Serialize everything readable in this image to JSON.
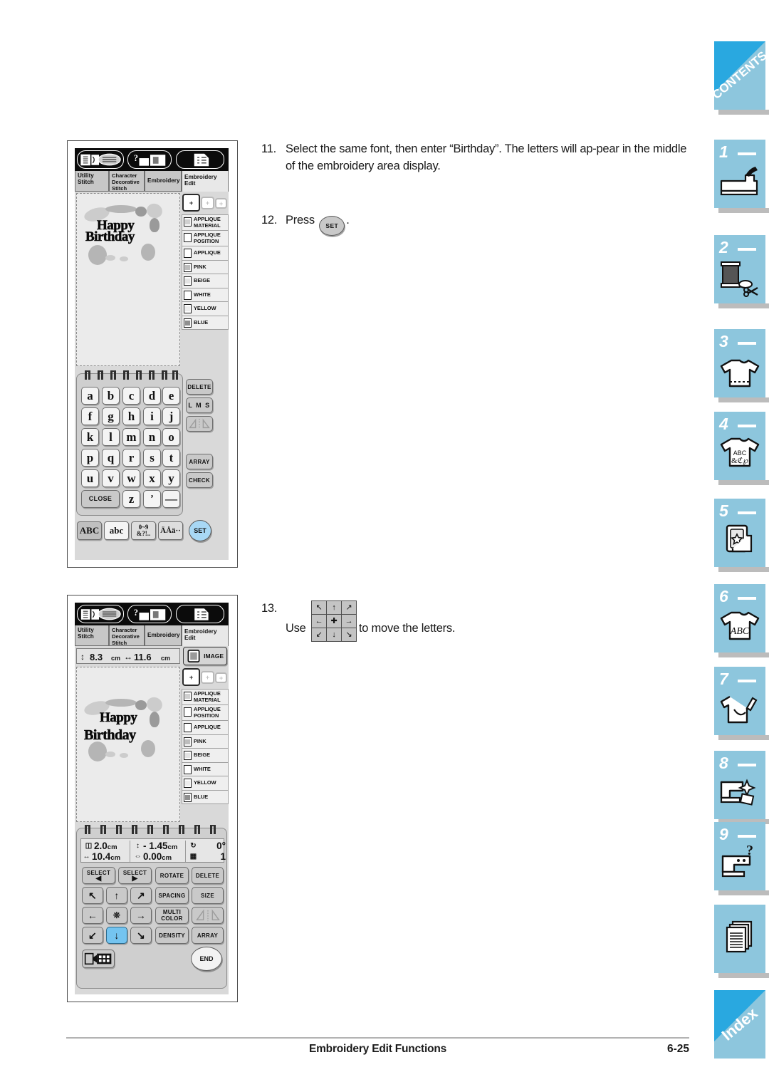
{
  "page": {
    "footer_title": "Embroidery Edit Functions",
    "footer_page": "6-25"
  },
  "instructions": [
    {
      "number": "11.",
      "text": "Select the same font, then enter “Birthday”. The letters will ap-pear in the middle of the embroidery area display."
    },
    {
      "number": "12.",
      "prefix": "Press",
      "button": "SET",
      "suffix": "."
    },
    {
      "number": "13.",
      "prefix": "Use",
      "suffix": "to move the letters."
    }
  ],
  "thumb_tabs": [
    {
      "label": "CONTENTS",
      "type": "corner",
      "icon": "contents-corner-icon"
    },
    {
      "label": "1",
      "type": "numbered",
      "icon": "sewing-machine-icon"
    },
    {
      "label": "2",
      "type": "numbered",
      "icon": "thread-spool-scissors-icon"
    },
    {
      "label": "3",
      "type": "numbered",
      "icon": "tshirt-stitch-icon"
    },
    {
      "label": "4",
      "type": "numbered",
      "icon": "tshirt-abc-icon"
    },
    {
      "label": "5",
      "type": "numbered",
      "icon": "embroidery-card-star-icon"
    },
    {
      "label": "6",
      "type": "numbered",
      "icon": "tshirt-letters-icon"
    },
    {
      "label": "7",
      "type": "numbered",
      "icon": "tshirt-needle-icon"
    },
    {
      "label": "8",
      "type": "numbered",
      "icon": "machine-sparkle-icon"
    },
    {
      "label": "9",
      "type": "numbered",
      "icon": "machine-question-icon"
    },
    {
      "label": "",
      "type": "plain",
      "icon": "pages-stack-icon"
    },
    {
      "label": "Index",
      "type": "corner",
      "icon": "index-corner-icon"
    }
  ],
  "screen_one": {
    "name": "character-entry-screen",
    "nav_icons": [
      "stitch-chart-icon",
      "machine-help-icon",
      "settings-list-icon"
    ],
    "tabs": [
      {
        "label": "Utility\nStitch",
        "active": false
      },
      {
        "label": "Character\nDecorative\nStitch",
        "active": false
      },
      {
        "label": "Embroidery",
        "active": false
      },
      {
        "label": "Embroidery\nEdit",
        "active": true
      }
    ],
    "design": {
      "line1": "Happy",
      "line2": "Birthday"
    },
    "hoops": [
      "hoop-large",
      "hoop-medium",
      "hoop-small"
    ],
    "color_list": [
      "APPLIQUE MATERIAL",
      "APPLIQUE POSITION",
      "APPLIQUE",
      "PINK",
      "BEIGE",
      "WHITE",
      "YELLOW",
      "BLUE"
    ],
    "keyboard": {
      "rows": [
        [
          "a",
          "b",
          "c",
          "d",
          "e"
        ],
        [
          "f",
          "g",
          "h",
          "i",
          "j"
        ],
        [
          "k",
          "l",
          "m",
          "n",
          "o"
        ],
        [
          "p",
          "q",
          "r",
          "s",
          "t"
        ],
        [
          "u",
          "v",
          "w",
          "x",
          "y"
        ]
      ],
      "last_row": {
        "close": "CLOSE",
        "keys": [
          "z",
          "’",
          "—"
        ]
      },
      "side_keys": [
        {
          "label": "DELETE",
          "name": "delete-key"
        },
        {
          "label": "L M S",
          "name": "size-lms-key"
        },
        {
          "label": "",
          "name": "mirror-key"
        },
        {
          "label": "ARRAY",
          "name": "array-key"
        },
        {
          "label": "CHECK",
          "name": "check-key"
        }
      ],
      "mode_tabs": [
        {
          "label": "ABC",
          "selected": true
        },
        {
          "label": "abc",
          "selected": false
        },
        {
          "label": "0~9\n&?!..",
          "selected": false
        },
        {
          "label": "ÄÅä··",
          "selected": false
        }
      ],
      "set_button": "SET"
    }
  },
  "screen_two": {
    "name": "embroidery-edit-screen",
    "nav_icons": [
      "stitch-chart-icon",
      "machine-help-icon",
      "settings-list-icon"
    ],
    "tabs": [
      {
        "label": "Utility\nStitch",
        "active": false
      },
      {
        "label": "Character\nDecorative\nStitch",
        "active": false
      },
      {
        "label": "Embroidery",
        "active": false
      },
      {
        "label": "Embroidery\nEdit",
        "active": true
      }
    ],
    "size_bar": {
      "height": "8.3",
      "height_unit": "cm",
      "width": "11.6",
      "width_unit": "cm"
    },
    "image_button": "IMAGE",
    "design": {
      "line1": "Happy",
      "line2": "Birthday"
    },
    "color_list": [
      "APPLIQUE MATERIAL",
      "APPLIQUE POSITION",
      "APPLIQUE",
      "PINK",
      "BEIGE",
      "WHITE",
      "YELLOW",
      "BLUE"
    ],
    "stats": {
      "vertical_size": "2.0",
      "vertical_unit": "cm",
      "horizontal_size": "10.4",
      "horizontal_unit": "cm",
      "vertical_offset": "- 1.45",
      "vertical_offset_unit": "cm",
      "horizontal_offset": "0.00",
      "horizontal_offset_unit": "cm",
      "rotation": "0°",
      "count": "1"
    },
    "controls": {
      "select_prev": "SELECT",
      "select_next": "SELECT",
      "rotate": "ROTATE",
      "delete": "DELETE",
      "spacing": "SPACING",
      "size": "SIZE",
      "multi_color": "MULTI COLOR",
      "mirror": "",
      "density": "DENSITY",
      "array": "ARRAY",
      "end": "END"
    }
  }
}
